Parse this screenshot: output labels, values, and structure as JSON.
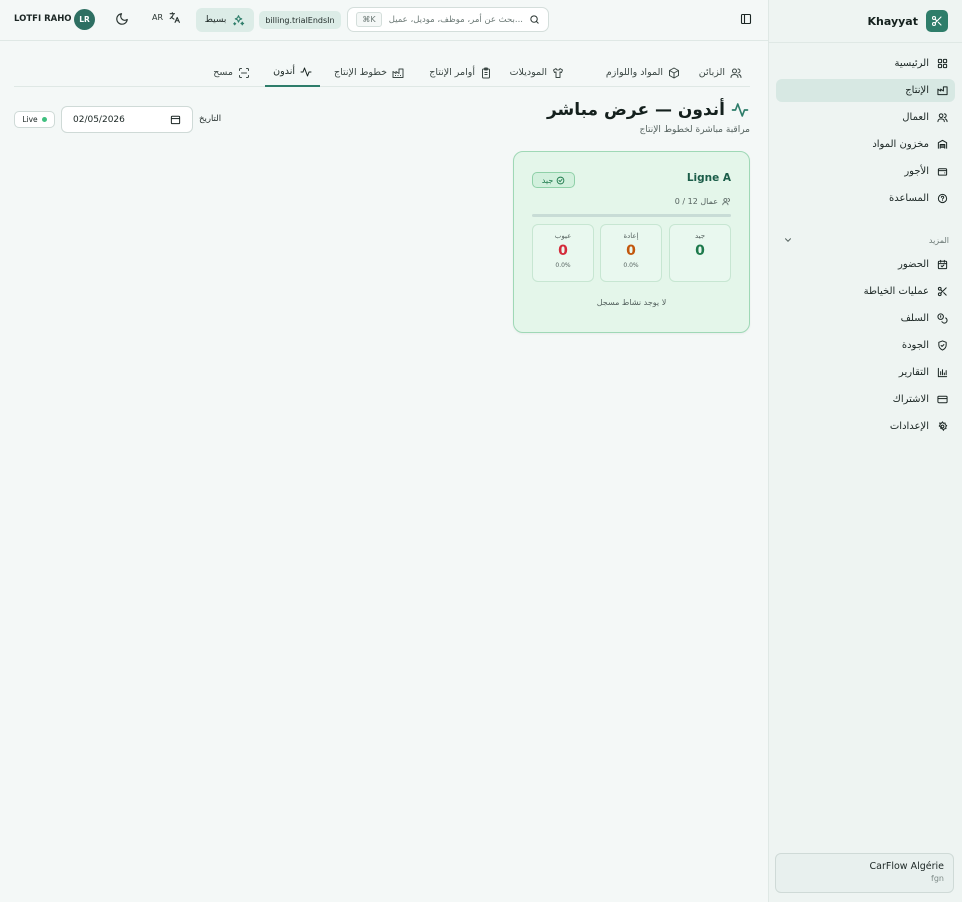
{
  "app": {
    "brand": "Khayyat"
  },
  "sidebar": {
    "items": [
      {
        "label": "الرئيسية",
        "icon": "dashboard-icon"
      },
      {
        "label": "الإنتاج",
        "icon": "factory-icon",
        "active": true
      },
      {
        "label": "العمال",
        "icon": "users-icon"
      },
      {
        "label": "مخزون المواد",
        "icon": "warehouse-icon"
      },
      {
        "label": "الأجور",
        "icon": "wallet-icon"
      },
      {
        "label": "المساعدة",
        "icon": "help-icon"
      }
    ],
    "more_label": "المزيد",
    "more_items": [
      {
        "label": "الحضور",
        "icon": "calendar-check-icon"
      },
      {
        "label": "عمليات الخياطة",
        "icon": "scissors-icon"
      },
      {
        "label": "السلف",
        "icon": "coins-icon"
      },
      {
        "label": "الجودة",
        "icon": "shield-check-icon"
      },
      {
        "label": "التقارير",
        "icon": "bar-chart-icon"
      },
      {
        "label": "الاشتراك",
        "icon": "credit-card-icon"
      },
      {
        "label": "الإعدادات",
        "icon": "settings-icon"
      }
    ],
    "org": {
      "name": "CarFlow Algérie",
      "sub": "fgn"
    }
  },
  "topbar": {
    "user_name": "LOTFI RAHO",
    "avatar_initials": "LR",
    "lang": "AR",
    "plan": "بسيط",
    "billing": "billing.trialEndsIn",
    "search_placeholder": "بحث عن أمر، موظف، موديل، عميل...",
    "search_shortcut": "⌘K"
  },
  "tabs": [
    {
      "label": "الزبائن",
      "icon": "users-icon"
    },
    {
      "label": "المواد واللوازم",
      "icon": "package-icon"
    },
    {
      "label": "الموديلات",
      "icon": "shirt-icon"
    },
    {
      "label": "أوامر الإنتاج",
      "icon": "clipboard-icon"
    },
    {
      "label": "خطوط الإنتاج",
      "icon": "factory-icon"
    },
    {
      "label": "أندون",
      "icon": "activity-icon",
      "active": true
    },
    {
      "label": "مسح",
      "icon": "scan-icon"
    }
  ],
  "page": {
    "title": "أندون — عرض مباشر",
    "subtitle": "مراقبة مباشرة لخطوط الإنتاج",
    "date_label": "التاريخ",
    "date_value": "02/05/2026",
    "live_label": "Live"
  },
  "line_card": {
    "name": "Ligne A",
    "status": "جيد",
    "workers": "0 / 12 عمال",
    "progress": 0,
    "stats": [
      {
        "label": "جيد",
        "value": "0",
        "pct": "",
        "color": "#1e7a4c"
      },
      {
        "label": "إعادة",
        "value": "0",
        "pct": "0.0%",
        "color": "#c2570c"
      },
      {
        "label": "عيوب",
        "value": "0",
        "pct": "0.0%",
        "color": "#d42b3a"
      }
    ],
    "no_activity": "لا يوجد نشاط مسجل"
  },
  "colors": {
    "accent": "#2e7d6a",
    "good": "#1e7a4c",
    "rework": "#c2570c",
    "defect": "#d42b3a"
  }
}
